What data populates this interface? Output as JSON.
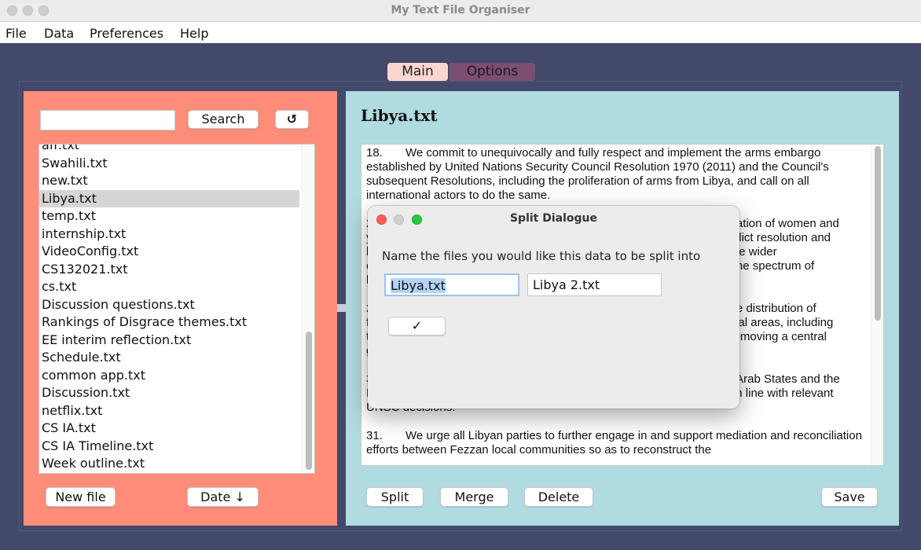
{
  "window": {
    "title": "My Text File Organiser"
  },
  "menu": [
    "File",
    "Data",
    "Preferences",
    "Help"
  ],
  "tabs": {
    "main": "Main",
    "options": "Options"
  },
  "left": {
    "search_placeholder": "",
    "search_label": "Search",
    "refresh_icon": "↺",
    "files": [
      "aff.txt",
      "Swahili.txt",
      "new.txt",
      "Libya.txt",
      "temp.txt",
      "internship.txt",
      "VideoConfig.txt",
      "CS132021.txt",
      "cs.txt",
      "Discussion questions.txt",
      "Rankings of Disgrace themes.txt",
      "EE interim reflection.txt",
      "Schedule.txt",
      "common app.txt",
      "Discussion.txt",
      "netflix.txt",
      "CS IA.txt",
      "CS IA Timeline.txt",
      "Week  outline.txt"
    ],
    "selected_file": "Libya.txt",
    "new_file_label": "New file",
    "sort_label": "Date ↓"
  },
  "right": {
    "doc_title": "Libya.txt",
    "paragraphs": [
      "18.       We commit to unequivocally and fully respect and implement the arms embargo established by United Nations Security Council Resolution 1970 (2011) and the Council's subsequent Resolutions, including the proliferation of arms from Libya, and call on all international actors to do the same.",
      "2                                                                                                               ation of women and\ny                                                                                                             nflict resolution and\nl                                                                                                              ate wider\ne                                                                                                              the spectrum of\nl",
      "2                                                                                                               e distribution of\nf                                                                                                              ical areas, including\nt                                                                                                              removing a central\ng",
      "3                                                                                                               Arab States and the\nEuropean Union to act against Libyan spoilers of the political process, in line with relevant UNSC decisions.",
      "31.       We urge all Libyan parties to further engage in and support mediation and reconciliation efforts between Fezzan local communities so as to reconstruct the"
    ],
    "buttons": {
      "split": "Split",
      "merge": "Merge",
      "delete": "Delete",
      "save": "Save"
    }
  },
  "dialog": {
    "title": "Split Dialogue",
    "prompt": "Name the files you would like this data to be split into",
    "name1": "Libya.txt",
    "name2": "Libya 2.txt",
    "confirm": "✓"
  },
  "colors": {
    "background": "#42496a",
    "left_panel": "#ff8d7a",
    "right_panel": "#b0dbe0",
    "tab_main": "#fbd6d0",
    "tab_options": "#7c4e72",
    "close": "#ff5f57",
    "minimize": "#d0d0d0",
    "maximize": "#28c840"
  }
}
